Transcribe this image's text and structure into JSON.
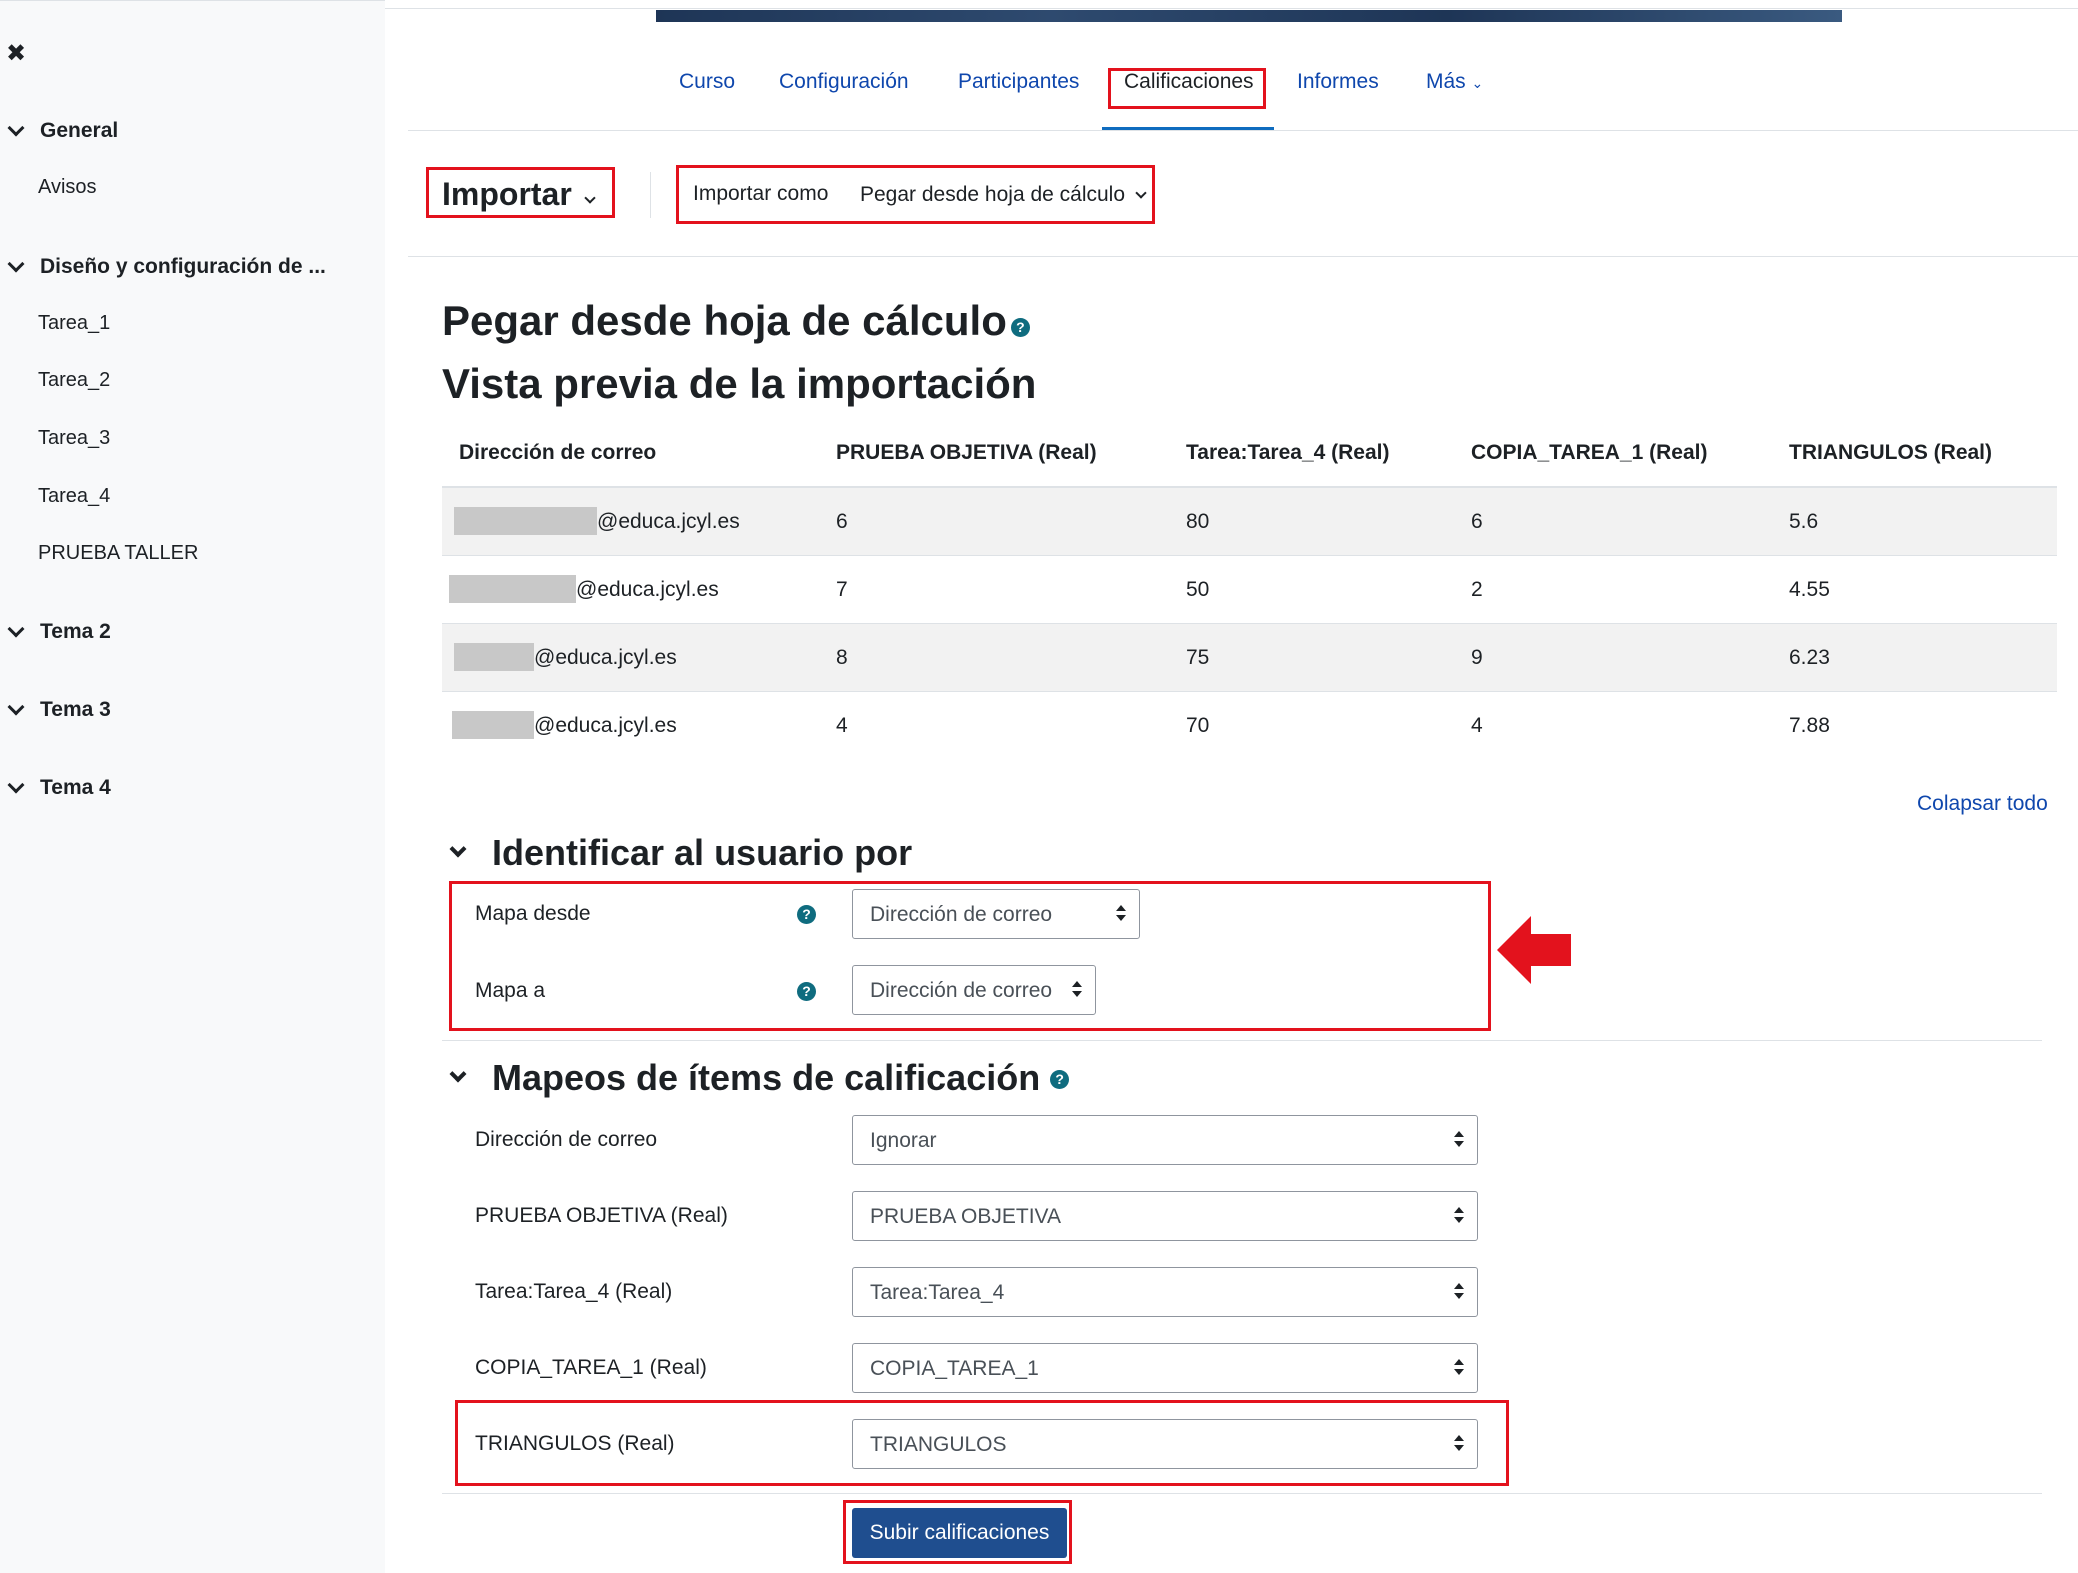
{
  "sidebar": {
    "close_icon": "close-icon",
    "sections": [
      {
        "label": "General",
        "items": [
          "Avisos"
        ]
      },
      {
        "label": "Diseño y configuración de ...",
        "items": [
          "Tarea_1",
          "Tarea_2",
          "Tarea_3",
          "Tarea_4",
          "PRUEBA TALLER"
        ]
      },
      {
        "label": "Tema 2",
        "items": []
      },
      {
        "label": "Tema 3",
        "items": []
      },
      {
        "label": "Tema 4",
        "items": []
      }
    ]
  },
  "nav": {
    "tabs": [
      "Curso",
      "Configuración",
      "Participantes",
      "Calificaciones",
      "Informes",
      "Más"
    ],
    "active": "Calificaciones"
  },
  "toolbar": {
    "importar": "Importar",
    "import_as_label": "Importar como",
    "import_as_value": "Pegar desde hoja de cálculo"
  },
  "page": {
    "title": "Pegar desde hoja de cálculo",
    "subtitle": "Vista previa de la importación"
  },
  "preview": {
    "headers": [
      "Dirección de correo",
      "PRUEBA OBJETIVA (Real)",
      "Tarea:Tarea_4 (Real)",
      "COPIA_TAREA_1 (Real)",
      "TRIANGULOS (Real)"
    ],
    "rows": [
      [
        "@educa.jcyl.es",
        "6",
        "80",
        "6",
        "5.6"
      ],
      [
        "@educa.jcyl.es",
        "7",
        "50",
        "2",
        "4.55"
      ],
      [
        "@educa.jcyl.es",
        "8",
        "75",
        "9",
        "6.23"
      ],
      [
        "@educa.jcyl.es",
        "4",
        "70",
        "4",
        "7.88"
      ]
    ]
  },
  "collapse_all": "Colapsar todo",
  "identify": {
    "heading": "Identificar al usuario por",
    "map_from_label": "Mapa desde",
    "map_from_value": "Dirección de correo",
    "map_to_label": "Mapa a",
    "map_to_value": "Dirección de correo"
  },
  "mappings": {
    "heading": "Mapeos de ítems de calificación",
    "rows": [
      {
        "label": "Dirección de correo",
        "value": "Ignorar"
      },
      {
        "label": "PRUEBA OBJETIVA (Real)",
        "value": "PRUEBA OBJETIVA"
      },
      {
        "label": "Tarea:Tarea_4 (Real)",
        "value": "Tarea:Tarea_4"
      },
      {
        "label": "COPIA_TAREA_1 (Real)",
        "value": "COPIA_TAREA_1"
      },
      {
        "label": "TRIANGULOS (Real)",
        "value": "TRIANGULOS"
      }
    ]
  },
  "submit_label": "Subir calificaciones",
  "colors": {
    "accent": "#0f47ad",
    "highlight": "#e3121d",
    "button": "#1f4e8f"
  }
}
